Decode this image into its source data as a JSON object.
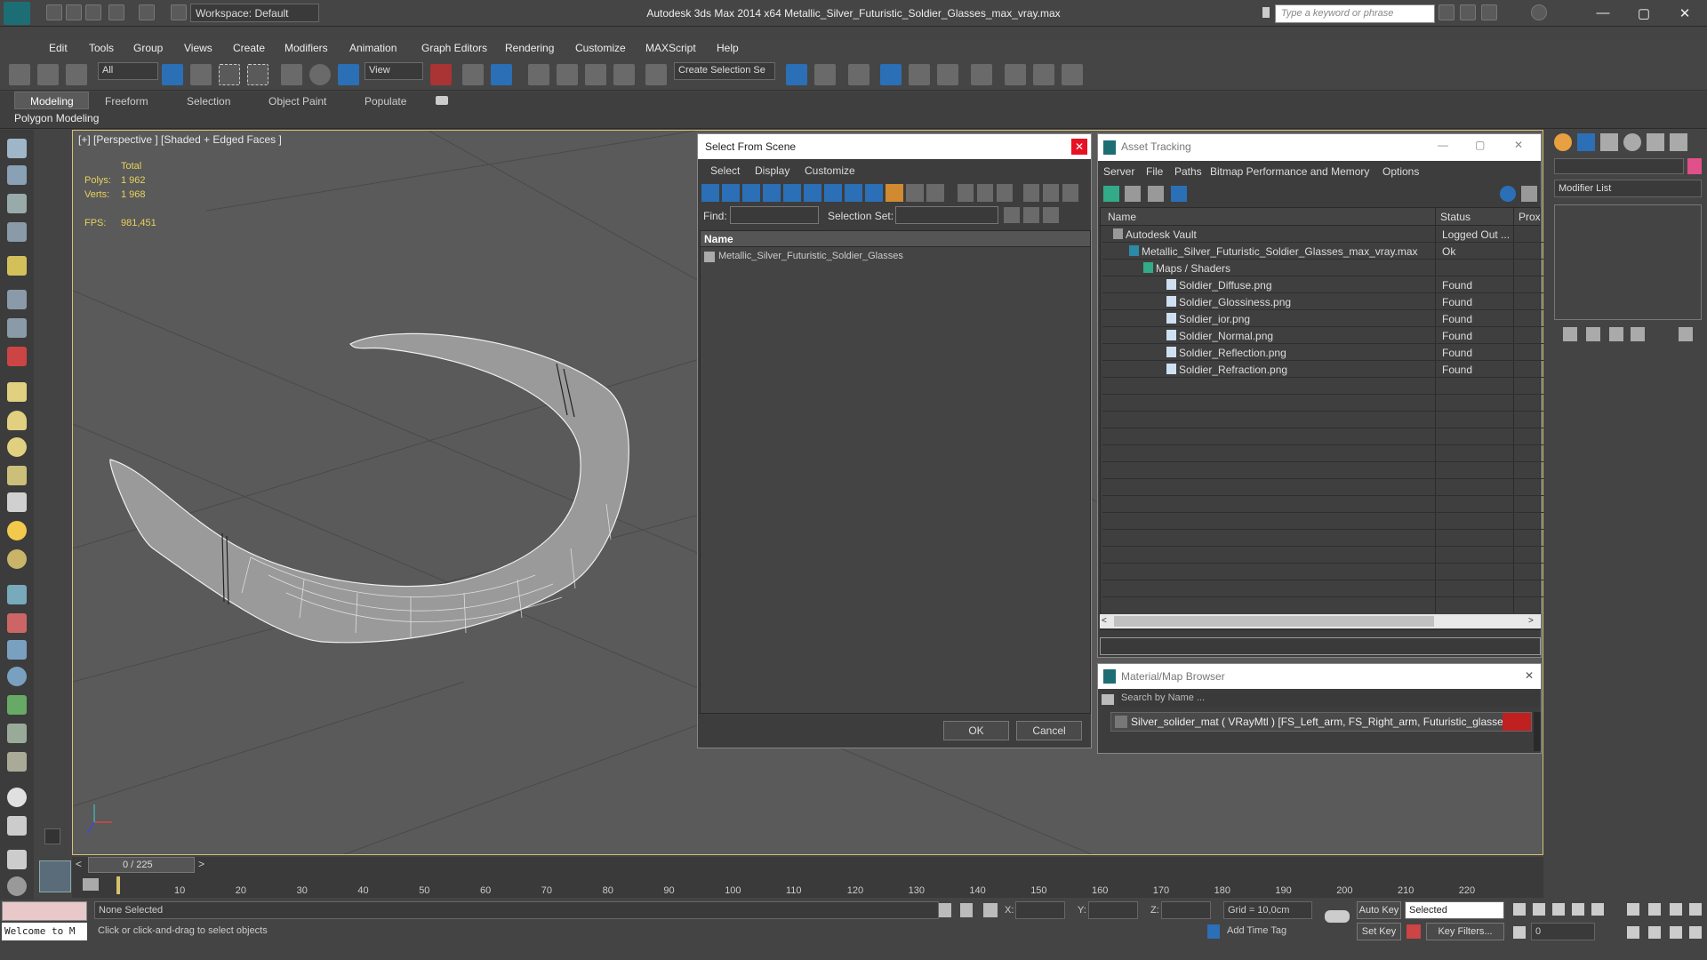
{
  "titlebar": {
    "workspace": "Workspace: Default",
    "title": "Autodesk 3ds Max  2014 x64     Metallic_Silver_Futuristic_Soldier_Glasses_max_vray.max",
    "search_placeholder": "Type a keyword or phrase"
  },
  "menu": [
    "Edit",
    "Tools",
    "Group",
    "Views",
    "Create",
    "Modifiers",
    "Animation",
    "Graph Editors",
    "Rendering",
    "Customize",
    "MAXScript",
    "Help"
  ],
  "toolbar": {
    "filter": "All",
    "ref_coord": "View",
    "selection_set": "Create Selection Se"
  },
  "ribbon": {
    "tabs": [
      "Modeling",
      "Freeform",
      "Selection",
      "Object Paint",
      "Populate"
    ],
    "sub": "Polygon Modeling"
  },
  "viewport": {
    "label": "[+] [Perspective ] [Shaded + Edged Faces ]",
    "total": "Total",
    "polys_label": "Polys:",
    "polys": "1 962",
    "verts_label": "Verts:",
    "verts": "1 968",
    "fps_label": "FPS:",
    "fps": "981,451"
  },
  "select_dialog": {
    "title": "Select From Scene",
    "menus": [
      "Select",
      "Display",
      "Customize"
    ],
    "find_label": "Find:",
    "selset_label": "Selection Set:",
    "col_name": "Name",
    "item": "Metallic_Silver_Futuristic_Soldier_Glasses",
    "ok": "OK",
    "cancel": "Cancel"
  },
  "asset_tracking": {
    "title": "Asset Tracking",
    "menus": [
      "Server",
      "File",
      "Paths",
      "Bitmap Performance and Memory",
      "Options"
    ],
    "col_name": "Name",
    "col_status": "Status",
    "col_prox": "Prox",
    "rows": [
      {
        "name": "Autodesk Vault",
        "status": "Logged Out ..."
      },
      {
        "name": "Metallic_Silver_Futuristic_Soldier_Glasses_max_vray.max",
        "status": "Ok"
      },
      {
        "name": "Maps / Shaders",
        "status": ""
      },
      {
        "name": "Soldier_Diffuse.png",
        "status": "Found"
      },
      {
        "name": "Soldier_Glossiness.png",
        "status": "Found"
      },
      {
        "name": "Soldier_ior.png",
        "status": "Found"
      },
      {
        "name": "Soldier_Normal.png",
        "status": "Found"
      },
      {
        "name": "Soldier_Reflection.png",
        "status": "Found"
      },
      {
        "name": "Soldier_Refraction.png",
        "status": "Found"
      }
    ]
  },
  "material_browser": {
    "title": "Material/Map Browser",
    "search": "Search by Name ...",
    "item": "Silver_solider_mat  ( VRayMtl ) [FS_Left_arm, FS_Right_arm, Futuristic_glasses]"
  },
  "command_panel": {
    "modifier_list": "Modifier List"
  },
  "timeline": {
    "frame": "0 / 225",
    "ticks": [
      "10",
      "20",
      "30",
      "40",
      "50",
      "60",
      "70",
      "80",
      "90",
      "100",
      "110",
      "120",
      "130",
      "140",
      "150",
      "160",
      "170",
      "180",
      "190",
      "200",
      "210",
      "220"
    ]
  },
  "status": {
    "welcome": "Welcome to M",
    "none_selected": "None Selected",
    "hint": "Click or click-and-drag to select objects",
    "x_label": "X:",
    "y_label": "Y:",
    "z_label": "Z:",
    "grid": "Grid = 10,0cm",
    "add_time_tag": "Add Time Tag",
    "auto_key": "Auto Key",
    "selected": "Selected",
    "set_key": "Set Key",
    "key_filters": "Key Filters...",
    "frame_value": "0"
  },
  "colors": {
    "accent": "#2b6fb6",
    "vp_border": "#d8c070",
    "stat": "#e8d25a"
  }
}
